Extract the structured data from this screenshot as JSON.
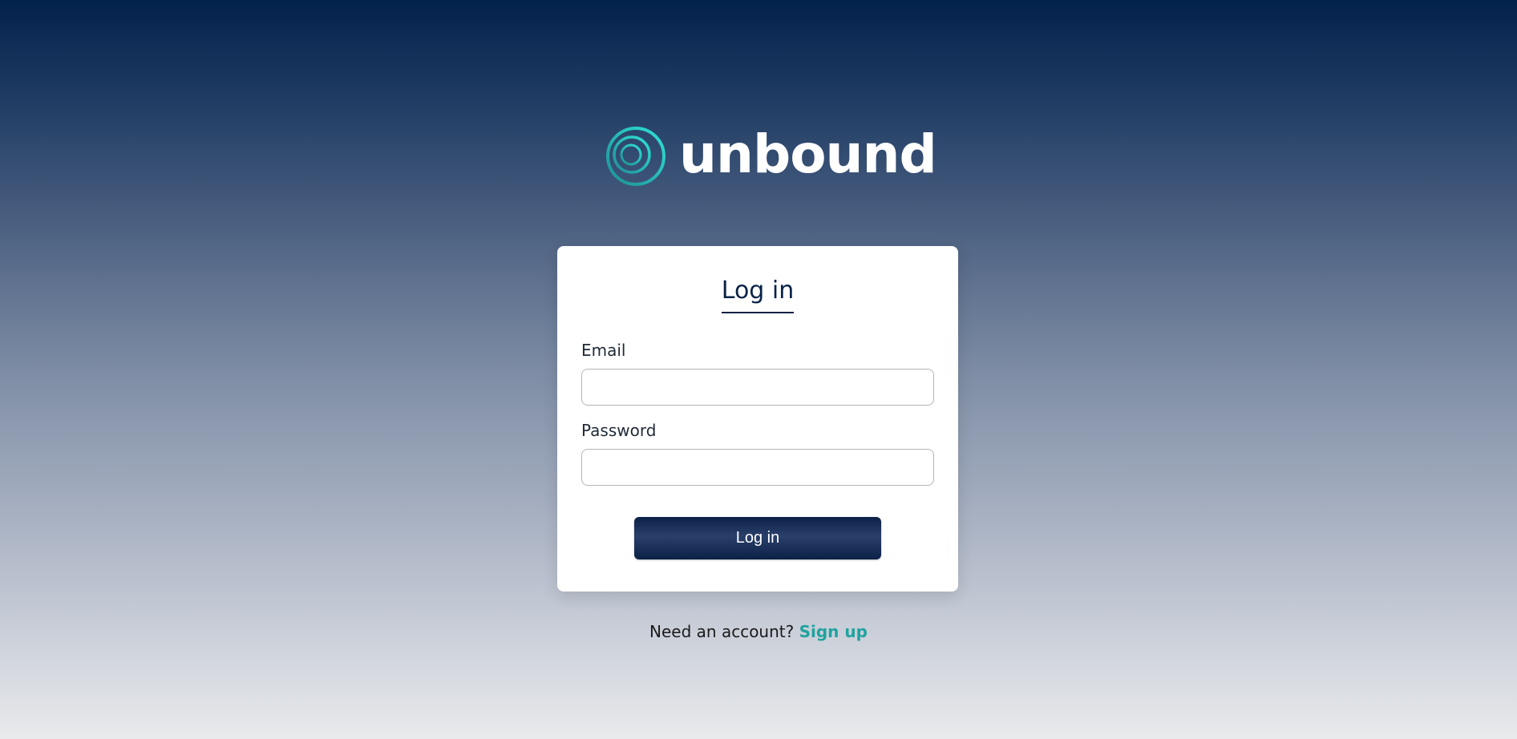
{
  "brand": {
    "name": "unbound",
    "logo_icon": "concentric-ring-logo-icon",
    "logo_colors": [
      "#1f8f93",
      "#2ee2d6"
    ]
  },
  "login_card": {
    "title": "Log in",
    "email_label": "Email",
    "email_value": "",
    "password_label": "Password",
    "password_value": "",
    "submit_label": "Log in"
  },
  "signup": {
    "prompt": "Need an account?",
    "link_label": "Sign up"
  },
  "colors": {
    "accent": "#20a39e",
    "primary_dark": "#0a2348"
  }
}
